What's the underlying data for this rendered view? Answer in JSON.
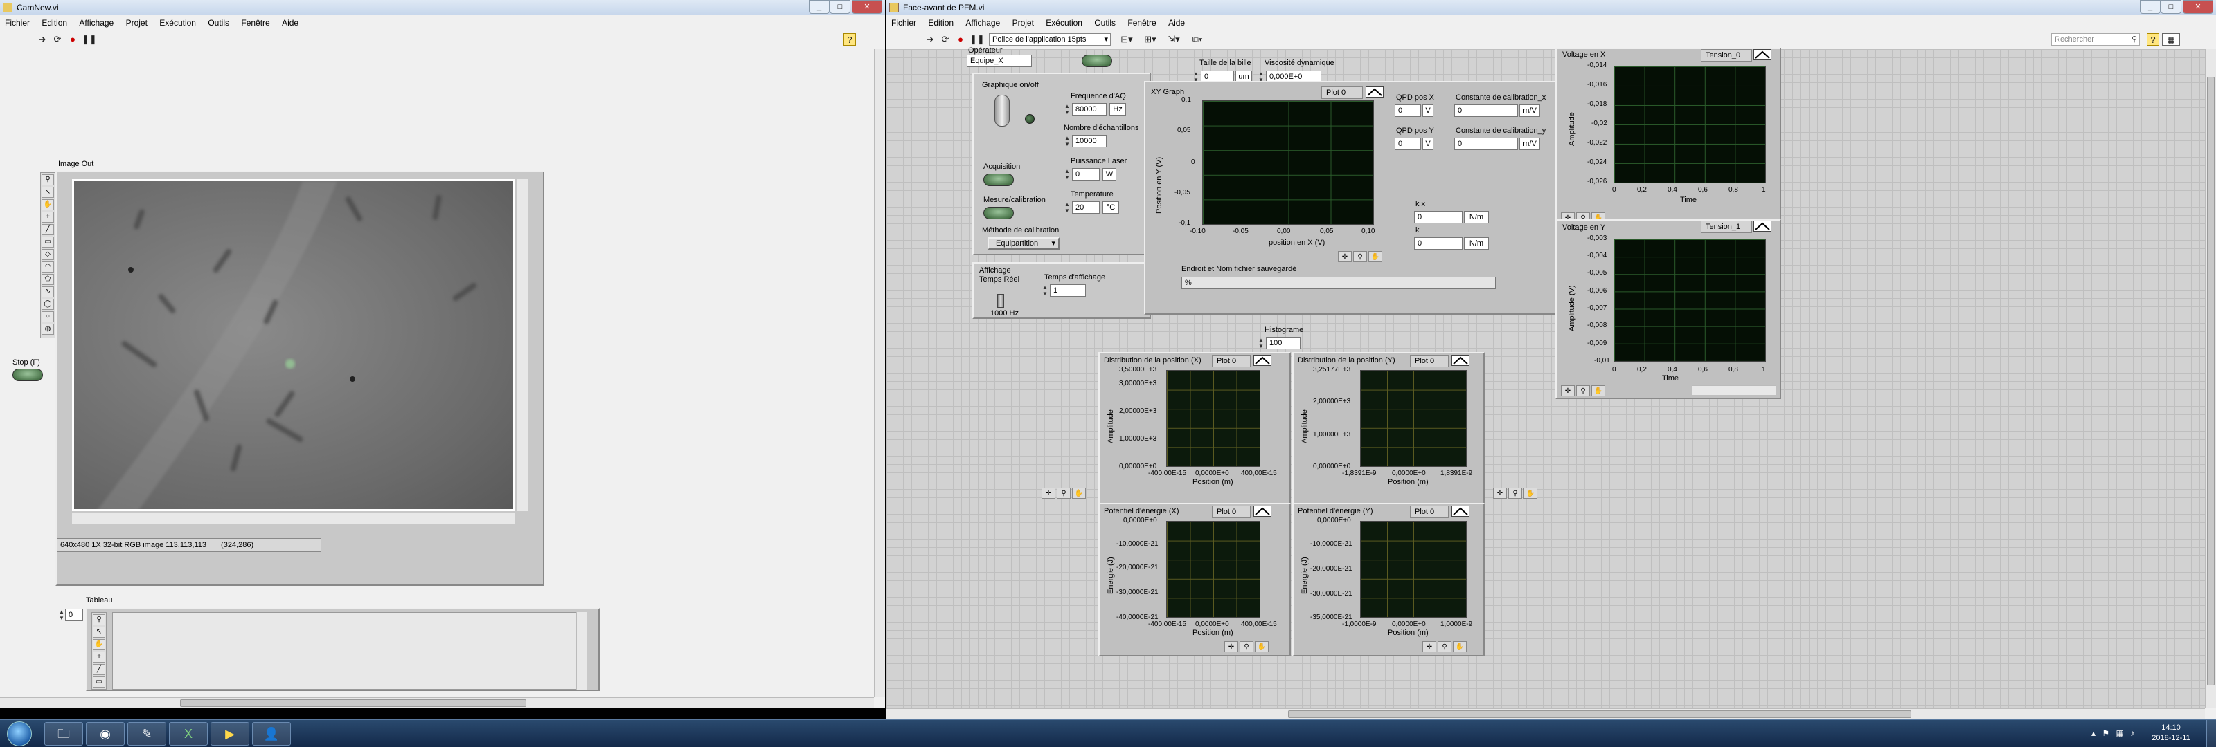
{
  "left_window": {
    "title": "CamNew.vi",
    "menu": [
      "Fichier",
      "Edition",
      "Affichage",
      "Projet",
      "Exécution",
      "Outils",
      "Fenêtre",
      "Aide"
    ],
    "image_out_label": "Image Out",
    "image_status": "640x480 1X 32-bit RGB image 113,113,113",
    "image_coords": "(324,286)",
    "stop_label": "Stop (F)",
    "tableau_label": "Tableau",
    "tableau_index": "0"
  },
  "right_window": {
    "title": "Face-avant de PFM.vi",
    "menu": [
      "Fichier",
      "Edition",
      "Affichage",
      "Projet",
      "Exécution",
      "Outils",
      "Fenêtre",
      "Aide"
    ],
    "font_select": "Police de l'application 15pts",
    "search_placeholder": "Rechercher",
    "operateur_label": "Opérateur",
    "operateur_value": "Equipe_X",
    "config": {
      "graph_onoff": "Graphique on/off",
      "acquisition": "Acquisition",
      "mesure": "Mesure/calibration",
      "methode": "Méthode de calibration",
      "methode_value": "Equipartition",
      "freq_label": "Fréquence d'AQ",
      "freq_value": "80000",
      "freq_unit": "Hz",
      "nb_label": "Nombre d'échantillons",
      "nb_value": "10000",
      "laser_label": "Puissance Laser",
      "laser_value": "0",
      "laser_unit": "W",
      "temp_label": "Temperature",
      "temp_value": "20",
      "temp_unit": "°C"
    },
    "affichage_label": "Affichage Temps Réel",
    "affichage_value": "1000 Hz",
    "temps_aff_label": "Temps d'affichage",
    "temps_aff_value": "1",
    "bille_label": "Taille de la bille",
    "bille_value": "0",
    "bille_unit": "um",
    "visco_label": "Viscosité dynamique",
    "visco_value": "0,000E+0",
    "xy_graph": {
      "title": "XY Graph",
      "plot": "Plot 0",
      "ylabel": "Position en Y (V)",
      "xlabel": "position en X (V)",
      "yticks": [
        "0,1",
        "0,05",
        "0",
        "-0,05",
        "-0,1"
      ],
      "xticks": [
        "-0,10",
        "-0,05",
        "0,00",
        "0,05",
        "0,10"
      ]
    },
    "qpd_x_label": "QPD pos X",
    "qpd_x_value": "0",
    "qpd_x_unit": "V",
    "qpd_y_label": "QPD pos Y",
    "qpd_y_value": "0",
    "qpd_y_unit": "V",
    "calib_x_label": "Constante de calibration_x",
    "calib_x_value": "0",
    "calib_x_unit": "m/V",
    "calib_y_label": "Constante de calibration_y",
    "calib_y_value": "0",
    "calib_y_unit": "m/V",
    "kx_label": "k x",
    "kx_value": "0",
    "kx_unit": "N/m",
    "ky_label": "k",
    "ky_value": "0",
    "ky_unit": "N/m",
    "file_label": "Endroit et Nom fichier sauvegardé",
    "file_value": "%",
    "histo_label": "Histograme",
    "histo_value": "100",
    "voltage_x": {
      "title": "Voltage en X",
      "plot": "Tension_0",
      "ylabel": "Amplitude",
      "xlabel": "Time",
      "yticks": [
        "-0,014",
        "-0,016",
        "-0,018",
        "-0,02",
        "-0,022",
        "-0,024",
        "-0,026"
      ],
      "xticks": [
        "0",
        "0,2",
        "0,4",
        "0,6",
        "0,8",
        "1"
      ]
    },
    "voltage_y": {
      "title": "Voltage en Y",
      "plot": "Tension_1",
      "ylabel": "Amplitude (V)",
      "xlabel": "Time",
      "yticks": [
        "-0,003",
        "-0,004",
        "-0,005",
        "-0,006",
        "-0,007",
        "-0,008",
        "-0,009",
        "-0,01"
      ],
      "xticks": [
        "0",
        "0,2",
        "0,4",
        "0,6",
        "0,8",
        "1"
      ]
    },
    "dist_x": {
      "title": "Distribution de la position (X)",
      "plot": "Plot 0",
      "ylabel": "Amplitude",
      "xlabel": "Position (m)",
      "yticks": [
        "3,50000E+3",
        "3,00000E+3",
        "2,00000E+3",
        "1,00000E+3",
        "0,00000E+0"
      ],
      "xticks": [
        "-400,00E-15",
        "0,0000E+0",
        "400,00E-15"
      ]
    },
    "dist_y": {
      "title": "Distribution de la position (Y)",
      "plot": "Plot 0",
      "ylabel": "Amplitude",
      "xlabel": "Position (m)",
      "yticks": [
        "3,25177E+3",
        "2,00000E+3",
        "1,00000E+3",
        "0,00000E+0"
      ],
      "xticks": [
        "-1,8391E-9",
        "0,0000E+0",
        "1,8391E-9"
      ]
    },
    "pot_x": {
      "title": "Potentiel d'énergie (X)",
      "plot": "Plot 0",
      "ylabel": "Energie (J)",
      "xlabel": "Position (m)",
      "yticks": [
        "0,0000E+0",
        "-10,0000E-21",
        "-20,0000E-21",
        "-30,0000E-21",
        "-40,0000E-21"
      ],
      "xticks": [
        "-400,00E-15",
        "0,0000E+0",
        "400,00E-15"
      ]
    },
    "pot_y": {
      "title": "Potentiel d'énergie (Y)",
      "plot": "Plot 0",
      "ylabel": "Energie (J)",
      "xlabel": "Position (m)",
      "yticks": [
        "0,0000E+0",
        "-10,0000E-21",
        "-20,0000E-21",
        "-30,0000E-21",
        "-35,0000E-21"
      ],
      "xticks": [
        "-1,0000E-9",
        "0,0000E+0",
        "1,0000E-9"
      ]
    }
  },
  "taskbar": {
    "time": "14:10",
    "date": "2018-12-11"
  }
}
